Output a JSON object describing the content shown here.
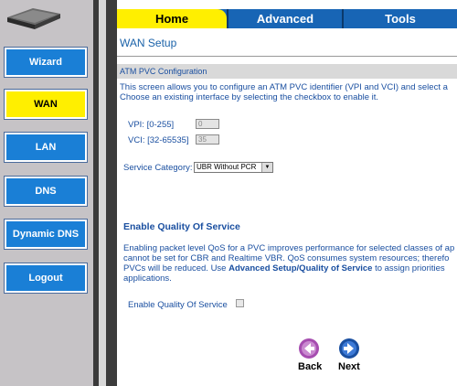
{
  "sidebar": {
    "items": [
      {
        "label": "Wizard",
        "active": false
      },
      {
        "label": "WAN",
        "active": true
      },
      {
        "label": "LAN",
        "active": false
      },
      {
        "label": "DNS",
        "active": false
      },
      {
        "label": "Dynamic DNS",
        "active": false
      },
      {
        "label": "Logout",
        "active": false
      }
    ]
  },
  "tabs": [
    {
      "label": "Home",
      "active": true
    },
    {
      "label": "Advanced",
      "active": false
    },
    {
      "label": "Tools",
      "active": false
    }
  ],
  "page": {
    "title": "WAN Setup",
    "section": "ATM PVC Configuration",
    "intro_line1": "This screen allows you to configure an ATM PVC identifier (VPI and VCI) and select a",
    "intro_line2": "Choose an existing interface by selecting the checkbox to enable it.",
    "vpi_label": "VPI: [0-255]",
    "vpi_value": "0",
    "vci_label": "VCI: [32-65535]",
    "vci_value": "35",
    "service_label": "Service Category:",
    "service_value": "UBR Without PCR",
    "qos_heading": "Enable Quality Of Service",
    "qos_line1": "Enabling packet level QoS for a PVC improves performance for selected classes of ap",
    "qos_line2": "cannot be set for CBR and Realtime VBR.  QoS consumes system resources; therefo",
    "qos_line3a": "PVCs will be reduced. Use ",
    "qos_line3b": "Advanced Setup/Quality of Service",
    "qos_line3c": " to assign priorities",
    "qos_line4": "applications.",
    "qos_checkbox_label": "Enable Quality Of Service",
    "qos_checked": false
  },
  "nav": {
    "back_label": "Back",
    "next_label": "Next"
  },
  "colors": {
    "accent_blue": "#1a7fd6",
    "active_yellow": "#ffef00",
    "text_blue": "#1a4fa0"
  }
}
